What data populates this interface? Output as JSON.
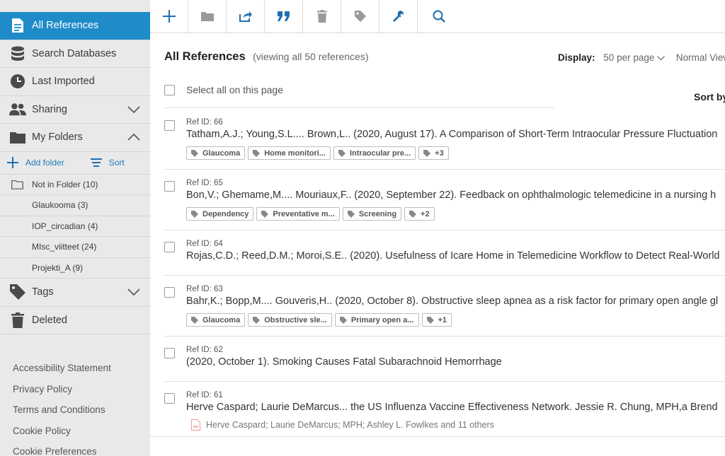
{
  "sidebar": {
    "items": [
      {
        "label": "All References",
        "icon": "document-icon"
      },
      {
        "label": "Search Databases",
        "icon": "database-icon"
      },
      {
        "label": "Last Imported",
        "icon": "clock-icon"
      },
      {
        "label": "Sharing",
        "icon": "users-icon"
      },
      {
        "label": "My Folders",
        "icon": "folder-icon"
      }
    ],
    "folder_actions": {
      "add": "Add folder",
      "sort": "Sort"
    },
    "folders": [
      {
        "label": "Not in Folder (10)"
      },
      {
        "label": "Glaukooma (3)"
      },
      {
        "label": "IOP_circadian (4)"
      },
      {
        "label": "MIsc_viitteet (24)"
      },
      {
        "label": "Projekti_A (9)"
      }
    ],
    "tags": {
      "label": "Tags",
      "icon": "tag-icon"
    },
    "deleted": {
      "label": "Deleted",
      "icon": "trash-icon"
    },
    "footer": [
      "Accessibility Statement",
      "Privacy Policy",
      "Terms and Conditions",
      "Cookie Policy",
      "Cookie Preferences"
    ]
  },
  "toolbar": [
    "plus-icon",
    "folder-icon",
    "share-icon",
    "quote-icon",
    "trash-icon",
    "tag-icon",
    "wrench-icon",
    "search-icon"
  ],
  "main": {
    "title": "All References",
    "subtitle": "(viewing all 50 references)",
    "display_label": "Display:",
    "display_value": "50 per page",
    "view_mode": "Normal View",
    "select_all": "Select all on this page",
    "sort_by": "Sort by"
  },
  "refs": [
    {
      "id": "Ref ID: 66",
      "title": "Tatham,A.J.; Young,S.L.... Brown,L.. (2020, August 17). A Comparison of Short-Term Intraocular Pressure Fluctuation",
      "tags": [
        "Glaucoma",
        "Home monitori...",
        "Intraocular pre...",
        "+3"
      ]
    },
    {
      "id": "Ref ID: 65",
      "title": "Bon,V.; Ghemame,M.... Mouriaux,F.. (2020, September 22). Feedback on ophthalmologic telemedicine in a nursing h",
      "tags": [
        "Dependency",
        "Preventative m...",
        "Screening",
        "+2"
      ]
    },
    {
      "id": "Ref ID: 64",
      "title": "Rojas,C.D.; Reed,D.M.; Moroi,S.E.. (2020). Usefulness of Icare Home in Telemedicine Workflow to Detect Real-World",
      "tags": []
    },
    {
      "id": "Ref ID: 63",
      "title": "Bahr,K.; Bopp,M.... Gouveris,H.. (2020, October 8). Obstructive sleep apnea as a risk factor for primary open angle gl",
      "tags": [
        "Glaucoma",
        "Obstructive sle...",
        "Primary open a...",
        "+1"
      ]
    },
    {
      "id": "Ref ID: 62",
      "title": "(2020, October 1). Smoking Causes Fatal Subarachnoid Hemorrhage",
      "tags": []
    },
    {
      "id": "Ref ID: 61",
      "title": "Herve Caspard; Laurie DeMarcus... the US Influenza Vaccine Effectiveness Network. Jessie R. Chung, MPH,a Brend",
      "tags": [],
      "attachment": "Herve Caspard; Laurie DeMarcus; MPH; Ashley L. Fowlkes and 11 others"
    }
  ],
  "colors": {
    "accent": "#1f8bc8",
    "icon_blue": "#1f6fb0",
    "sidebar_bg": "#e9e9e9"
  }
}
